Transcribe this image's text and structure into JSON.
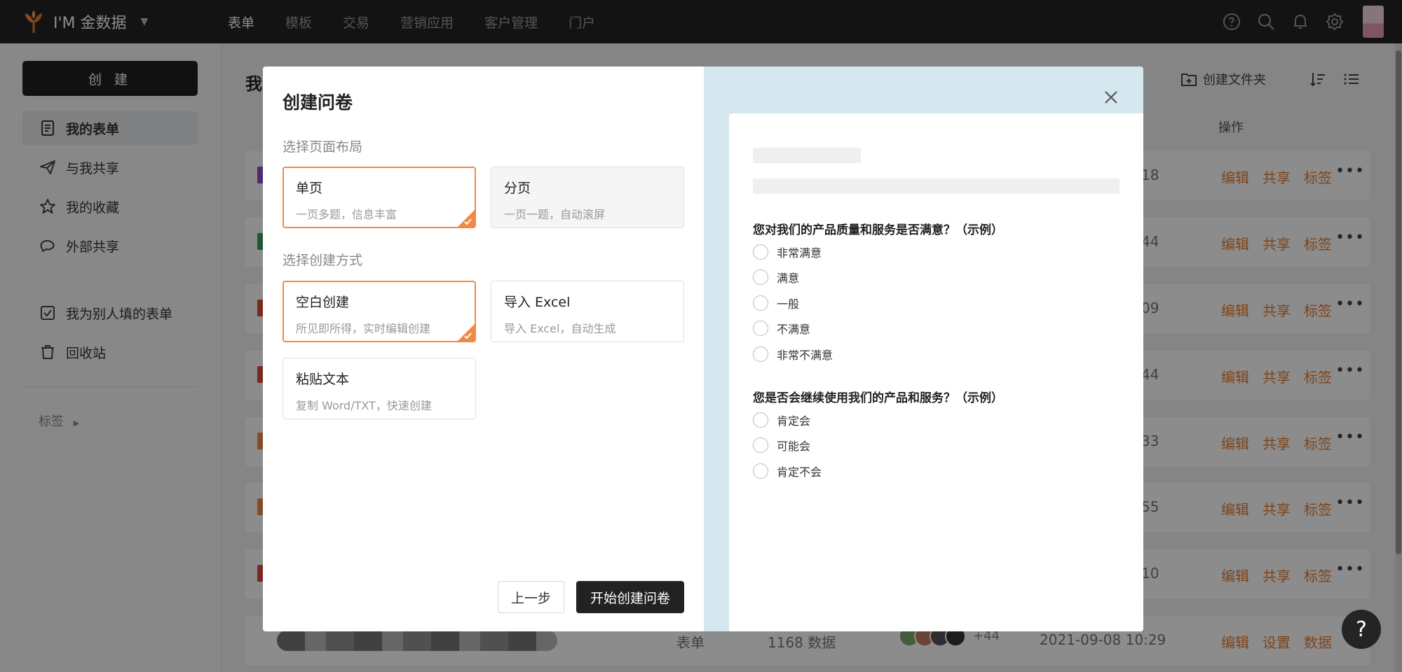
{
  "topbar": {
    "brand": "I'M 金数据",
    "nav": [
      "表单",
      "模板",
      "交易",
      "营销应用",
      "客户管理",
      "门户"
    ],
    "active_nav": 0,
    "icons": [
      "help-icon",
      "search-icon",
      "bell-icon",
      "gear-icon"
    ]
  },
  "sidebar": {
    "create_label": "创 建",
    "items": [
      {
        "label": "我的表单",
        "icon": "document-icon"
      },
      {
        "label": "与我共享",
        "icon": "send-icon"
      },
      {
        "label": "我的收藏",
        "icon": "star-icon"
      },
      {
        "label": "外部共享",
        "icon": "chat-share-icon"
      },
      {
        "label": "我为别人填的表单",
        "icon": "checkbox-icon"
      },
      {
        "label": "回收站",
        "icon": "trash-icon"
      }
    ],
    "tags_label": "标签"
  },
  "background": {
    "page_title": "我",
    "create_folder_label": "创建文件夹",
    "actions_header": "操作",
    "rows": [
      {
        "time_tail": "18",
        "actions": [
          "编辑",
          "共享",
          "标签"
        ],
        "chip": "#8a4fd0"
      },
      {
        "time_tail": "44",
        "actions": [
          "编辑",
          "共享",
          "标签"
        ],
        "chip": "#3aa35a"
      },
      {
        "time_tail": "09",
        "actions": [
          "编辑",
          "共享",
          "标签"
        ],
        "chip": "#e04a3c"
      },
      {
        "time_tail": "44",
        "actions": [
          "编辑",
          "共享",
          "标签"
        ],
        "chip": "#e04a3c"
      },
      {
        "time_tail": "33",
        "actions": [
          "编辑",
          "共享",
          "标签"
        ],
        "chip": "#f08a43"
      },
      {
        "time_tail": "55",
        "actions": [
          "编辑",
          "共享",
          "标签"
        ],
        "chip": "#f08a43"
      },
      {
        "time_tail": "10",
        "actions": [
          "编辑",
          "共享",
          "标签"
        ],
        "chip": "#e04a3c"
      }
    ],
    "last_row": {
      "type": "表单",
      "count": "1168 数据",
      "plus": "+44",
      "date": "2021-09-08 10:29",
      "actions": [
        "编辑",
        "设置",
        "数据"
      ]
    }
  },
  "modal": {
    "title": "创建问卷",
    "layout_label": "选择页面布局",
    "layout_options": [
      {
        "title": "单页",
        "desc": "一页多题，信息丰富",
        "selected": true
      },
      {
        "title": "分页",
        "desc": "一页一题，自动滚屏",
        "selected": false
      }
    ],
    "method_label": "选择创建方式",
    "method_options": [
      {
        "title": "空白创建",
        "desc": "所见即所得，实时编辑创建",
        "selected": true
      },
      {
        "title": "导入 Excel",
        "desc": "导入 Excel，自动生成",
        "selected": false
      },
      {
        "title": "粘贴文本",
        "desc": "复制 Word/TXT，快速创建",
        "selected": false
      }
    ],
    "prev_label": "上一步",
    "start_label": "开始创建问卷",
    "preview": {
      "questions": [
        {
          "title": "您对我们的产品质量和服务是否满意？（示例）",
          "options": [
            "非常满意",
            "满意",
            "一般",
            "不满意",
            "非常不满意"
          ]
        },
        {
          "title": "您是否会继续使用我们的产品和服务？（示例）",
          "options": [
            "肯定会",
            "可能会",
            "肯定不会"
          ]
        }
      ]
    }
  },
  "help_fab": "?",
  "colors": {
    "accent": "#f08a43",
    "dark": "#242424",
    "preview_bg": "#d5e7ef"
  }
}
